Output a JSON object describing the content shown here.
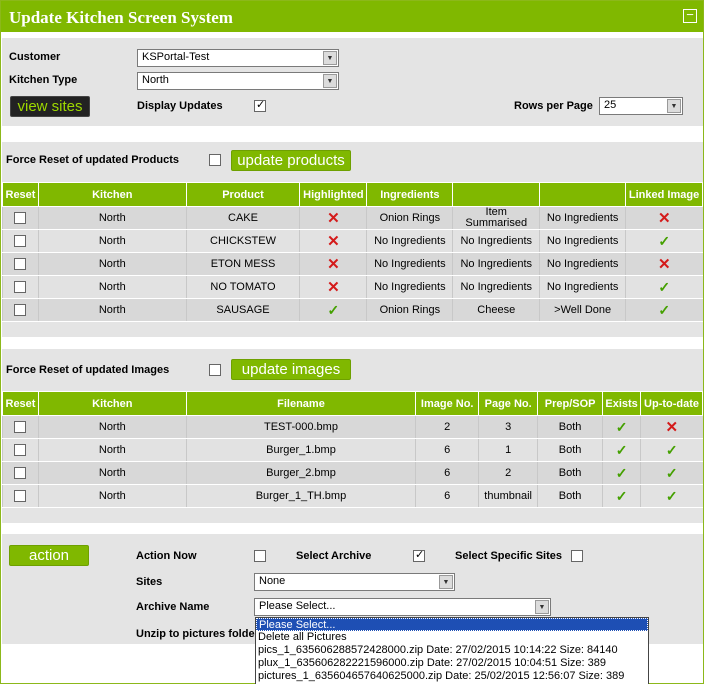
{
  "title": "Update Kitchen Screen System",
  "minimize_label": "−",
  "filters": {
    "customer_label": "Customer",
    "customer_value": "KSPortal-Test",
    "kitchen_type_label": "Kitchen Type",
    "kitchen_type_value": "North",
    "view_sites_label": "view sites",
    "display_updates_label": "Display Updates",
    "display_updates_checked": true,
    "rows_per_page_label": "Rows per Page",
    "rows_per_page_value": "25"
  },
  "products": {
    "force_reset_label": "Force Reset of updated Products",
    "update_button": "update products",
    "headers": [
      "Reset",
      "Kitchen",
      "Product",
      "Highlighted",
      "Ingredients",
      "",
      "",
      "Linked Image"
    ],
    "rows": [
      {
        "kitchen": "North",
        "product": "CAKE",
        "highlighted": false,
        "ing1": "Onion Rings",
        "ing2": "Item Summarised",
        "ing3": "No Ingredients",
        "linked": false
      },
      {
        "kitchen": "North",
        "product": "CHICKSTEW",
        "highlighted": false,
        "ing1": "No Ingredients",
        "ing2": "No Ingredients",
        "ing3": "No Ingredients",
        "linked": true
      },
      {
        "kitchen": "North",
        "product": "ETON MESS",
        "highlighted": false,
        "ing1": "No Ingredients",
        "ing2": "No Ingredients",
        "ing3": "No Ingredients",
        "linked": false
      },
      {
        "kitchen": "North",
        "product": "NO TOMATO",
        "highlighted": false,
        "ing1": "No Ingredients",
        "ing2": "No Ingredients",
        "ing3": "No Ingredients",
        "linked": true
      },
      {
        "kitchen": "North",
        "product": "SAUSAGE",
        "highlighted": true,
        "ing1": "Onion Rings",
        "ing2": "Cheese",
        "ing3": ">Well Done",
        "linked": true
      }
    ]
  },
  "images": {
    "force_reset_label": "Force Reset of updated Images",
    "update_button": "update images",
    "headers": [
      "Reset",
      "Kitchen",
      "Filename",
      "Image No.",
      "Page No.",
      "Prep/SOP",
      "Exists",
      "Up-to-date"
    ],
    "rows": [
      {
        "kitchen": "North",
        "filename": "TEST-000.bmp",
        "image_no": "2",
        "page_no": "3",
        "prep": "Both",
        "exists": true,
        "uptodate": false
      },
      {
        "kitchen": "North",
        "filename": "Burger_1.bmp",
        "image_no": "6",
        "page_no": "1",
        "prep": "Both",
        "exists": true,
        "uptodate": true
      },
      {
        "kitchen": "North",
        "filename": "Burger_2.bmp",
        "image_no": "6",
        "page_no": "2",
        "prep": "Both",
        "exists": true,
        "uptodate": true
      },
      {
        "kitchen": "North",
        "filename": "Burger_1_TH.bmp",
        "image_no": "6",
        "page_no": "thumbnail",
        "prep": "Both",
        "exists": true,
        "uptodate": true
      }
    ]
  },
  "action": {
    "action_button": "action",
    "action_now_label": "Action Now",
    "action_now_checked": false,
    "select_archive_label": "Select Archive",
    "select_archive_checked": true,
    "select_specific_sites_label": "Select Specific Sites",
    "select_specific_sites_checked": false,
    "sites_label": "Sites",
    "sites_value": "None",
    "archive_name_label": "Archive Name",
    "archive_name_value": "Please Select...",
    "unzip_label": "Unzip to pictures folde",
    "archive_options": [
      "Please Select...",
      "Delete all Pictures",
      "pics_1_635606288572428000.zip Date: 27/02/2015 10:14:22 Size: 84140",
      "plux_1_635606282221596000.zip Date: 27/02/2015 10:04:51 Size: 389",
      "pictures_1_635604657640625000.zip Date: 25/02/2015 12:56:07 Size: 389"
    ]
  },
  "colors": {
    "accent": "#80b800",
    "panel": "#e4e4e4",
    "cross": "#d41a1a",
    "tick": "#44a000"
  }
}
